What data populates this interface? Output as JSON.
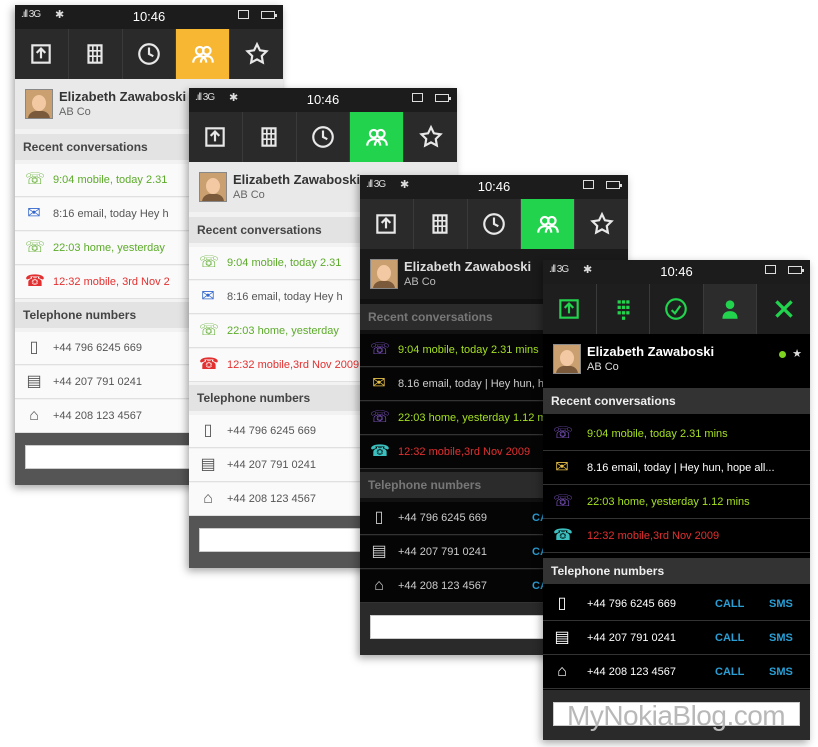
{
  "status": {
    "time": "10:46",
    "signal": ".ıll 3G",
    "bt": "✱"
  },
  "contact": {
    "name": "Elizabeth Zawaboski",
    "company": "AB Co"
  },
  "sections": {
    "recent": "Recent conversations",
    "phones": "Telephone numbers"
  },
  "conversations": [
    {
      "text": "9:04 mobile, today 2.31 mins",
      "text_short": "9:04 mobile, today 2.31",
      "kind": "outgoing-call"
    },
    {
      "text": "8.16 email, today | Hey hun, hope all...",
      "text_short": "8:16 email, today  Hey h",
      "kind": "email"
    },
    {
      "text": "22:03 home, yesterday 1.12 mins",
      "text_short": "22:03 home, yesterday",
      "kind": "incoming-call"
    },
    {
      "text": "12:32 mobile,3rd Nov 2009",
      "text_short": "12:32 mobile, 3rd Nov 2",
      "kind": "missed-call"
    }
  ],
  "phones": [
    {
      "number": "+44 796 6245 669",
      "type": "mobile"
    },
    {
      "number": "+44 207 791 0241",
      "type": "office"
    },
    {
      "number": "+44 208 123 4567",
      "type": "home"
    }
  ],
  "actions": {
    "call": "CALL",
    "sms": "SMS"
  },
  "colors": {
    "accent_orange": "#f7b733",
    "accent_green": "#22d34e",
    "call_green": "#5cab2a",
    "missed_red": "#e23030",
    "call_purple": "#8a5cd6",
    "call_teal": "#3bbfbf",
    "action_blue": "#2a9fd6"
  },
  "watermark": "MyNokiaBlog.com"
}
